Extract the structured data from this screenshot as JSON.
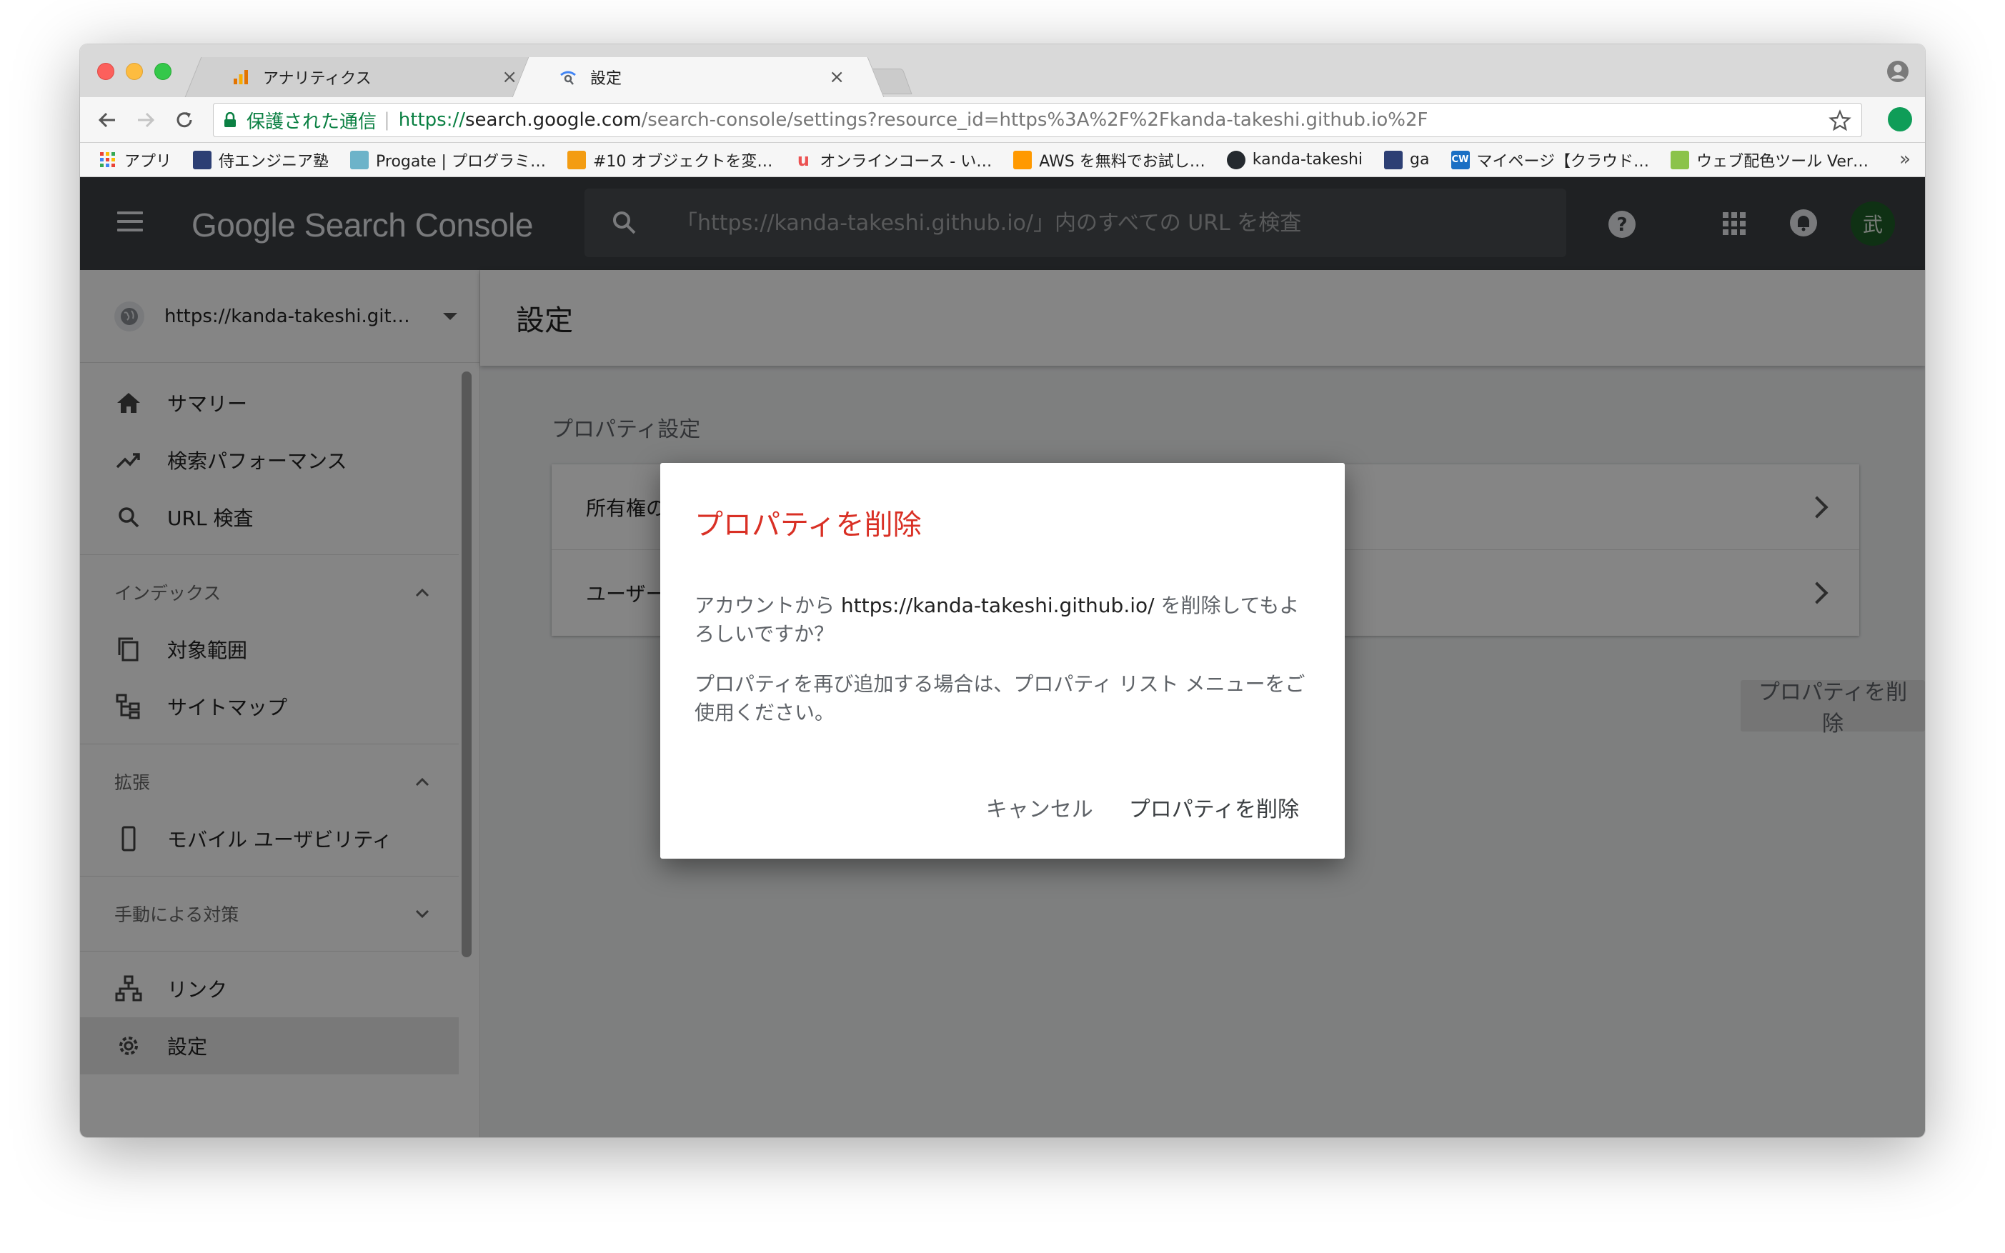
{
  "browser": {
    "tabs": [
      {
        "title": "アナリティクス",
        "close": "×"
      },
      {
        "title": "設定",
        "close": "×"
      }
    ],
    "address": {
      "secure_label": "保護された通信",
      "separator": "|",
      "protocol": "https://",
      "host": "search.google.com",
      "path": "/search-console/settings?resource_id=https%3A%2F%2Fkanda-takeshi.github.io%2F"
    },
    "bookmarks": [
      {
        "label": "アプリ",
        "color": "#4285f4"
      },
      {
        "label": "侍エンジニア塾",
        "color": "#2d3f74"
      },
      {
        "label": "Progate | プログラミ…",
        "color": "#6db3c9"
      },
      {
        "label": "#10 オブジェクトを変…",
        "color": "#f39c12"
      },
      {
        "label": "オンラインコース - い…",
        "color": "#ec5252"
      },
      {
        "label": "AWS を無料でお試し…",
        "color": "#ff9900"
      },
      {
        "label": "kanda-takeshi",
        "color": "#24292e"
      },
      {
        "label": "ga",
        "color": "#2d3f74"
      },
      {
        "label": "マイページ【クラウド…",
        "color": "#1a6fc4"
      },
      {
        "label": "ウェブ配色ツール Ver…",
        "color": "#8bc34a"
      }
    ],
    "bookmarks_more": "»"
  },
  "app": {
    "logo": "Google Search Console",
    "search_placeholder": "「https://kanda-takeshi.github.io/」内のすべての URL を検査",
    "avatar_initial": "武",
    "property": "https://kanda-takeshi.github.io/",
    "nav": {
      "summary": "サマリー",
      "performance": "検索パフォーマンス",
      "url_inspection": "URL 検査",
      "index_header": "インデックス",
      "coverage": "対象範囲",
      "sitemaps": "サイトマップ",
      "enhancements_header": "拡張",
      "mobile_usability": "モバイル ユーザビリティ",
      "manual_actions_header": "手動による対策",
      "links": "リンク",
      "settings": "設定"
    },
    "page_title": "設定",
    "section_title": "プロパティ設定",
    "card_rows": [
      "所有権の確認",
      "ユーザーと権限"
    ],
    "delete_property_button": "プロパティを削除"
  },
  "dialog": {
    "title": "プロパティを削除",
    "body_prefix": "アカウントから ",
    "body_url": "https://kanda-takeshi.github.io/",
    "body_suffix": " を削除してもよろしいですか？",
    "body_2": "プロパティを再び追加する場合は、プロパティ リスト メニューをご使用ください。",
    "cancel": "キャンセル",
    "confirm": "プロパティを削除"
  },
  "colors": {
    "appbar": "#3c4043",
    "dialog_title": "#d93025",
    "secure_green": "#0b8043"
  }
}
